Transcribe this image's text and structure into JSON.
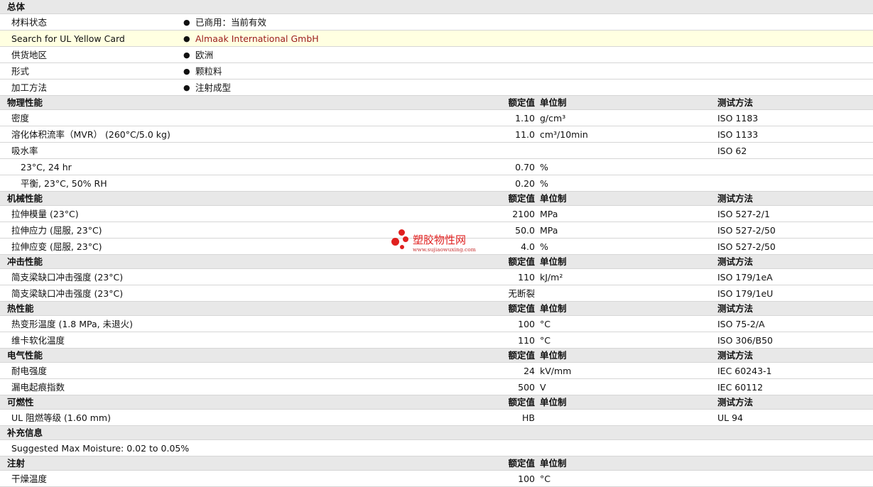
{
  "sections": [
    {
      "title": "总体",
      "columns": null,
      "rows": [
        {
          "label": "材料状态",
          "bullet": "●",
          "text": "已商用：当前有效"
        },
        {
          "label": "Search for UL Yellow Card",
          "bullet": "●",
          "text": "Almaak International GmbH",
          "highlight": true,
          "link": true
        },
        {
          "label": "供货地区",
          "bullet": "●",
          "text": "欧洲"
        },
        {
          "label": "形式",
          "bullet": "●",
          "text": "颗粒料"
        },
        {
          "label": "加工方法",
          "bullet": "●",
          "text": "注射成型"
        }
      ]
    },
    {
      "title": "物理性能",
      "columns": {
        "value": "额定值",
        "unit": "单位制",
        "test": "测试方法"
      },
      "rows": [
        {
          "label": "密度",
          "value": "1.10",
          "unit": "g/cm³",
          "test": "ISO 1183"
        },
        {
          "label": "溶化体积流率（MVR） (260°C/5.0 kg)",
          "value": "11.0",
          "unit": "cm³/10min",
          "test": "ISO 1133"
        },
        {
          "label": "吸水率",
          "test": "ISO 62"
        },
        {
          "label": "23°C, 24 hr",
          "value": "0.70",
          "unit": "%",
          "sub": true
        },
        {
          "label": "平衡, 23°C, 50% RH",
          "value": "0.20",
          "unit": "%",
          "sub": true
        }
      ]
    },
    {
      "title": "机械性能",
      "columns": {
        "value": "额定值",
        "unit": "单位制",
        "test": "测试方法"
      },
      "rows": [
        {
          "label": "拉伸模量 (23°C)",
          "value": "2100",
          "unit": "MPa",
          "test": "ISO 527-2/1"
        },
        {
          "label": "拉伸应力 (屈服, 23°C)",
          "value": "50.0",
          "unit": "MPa",
          "test": "ISO 527-2/50"
        },
        {
          "label": "拉伸应变 (屈服, 23°C)",
          "value": "4.0",
          "unit": "%",
          "test": "ISO 527-2/50"
        }
      ]
    },
    {
      "title": "冲击性能",
      "columns": {
        "value": "额定值",
        "unit": "单位制",
        "test": "测试方法"
      },
      "rows": [
        {
          "label": "简支梁缺口冲击强度 (23°C)",
          "value": "110",
          "unit": "kJ/m²",
          "test": "ISO 179/1eA"
        },
        {
          "label": "简支梁缺口冲击强度 (23°C)",
          "value": "无断裂",
          "test": "ISO 179/1eU"
        }
      ]
    },
    {
      "title": "热性能",
      "columns": {
        "value": "额定值",
        "unit": "单位制",
        "test": "测试方法"
      },
      "rows": [
        {
          "label": "热变形温度 (1.8 MPa, 未退火)",
          "value": "100",
          "unit": "°C",
          "test": "ISO 75-2/A"
        },
        {
          "label": "维卡软化温度",
          "value": "110",
          "unit": "°C",
          "test": "ISO 306/B50"
        }
      ]
    },
    {
      "title": "电气性能",
      "columns": {
        "value": "额定值",
        "unit": "单位制",
        "test": "测试方法"
      },
      "rows": [
        {
          "label": "耐电强度",
          "value": "24",
          "unit": "kV/mm",
          "test": "IEC 60243-1"
        },
        {
          "label": "漏电起痕指数",
          "value": "500",
          "unit": "V",
          "test": "IEC 60112"
        }
      ]
    },
    {
      "title": "可燃性",
      "columns": {
        "value": "额定值",
        "unit": "单位制",
        "test": "测试方法"
      },
      "rows": [
        {
          "label": "UL 阻燃等级 (1.60 mm)",
          "value": "HB",
          "test": "UL 94"
        }
      ]
    },
    {
      "title": "补充信息",
      "columns": null,
      "rows": [
        {
          "label": "Suggested Max Moisture: 0.02 to 0.05%"
        }
      ]
    },
    {
      "title": "注射",
      "columns": {
        "value": "额定值",
        "unit": "单位制"
      },
      "rows": [
        {
          "label": "干燥温度",
          "value": "100",
          "unit": "°C"
        }
      ]
    }
  ],
  "watermark": {
    "text": "塑胶物性网",
    "url": "www.sujiaowuxing.com",
    "color": "#e0201f"
  }
}
